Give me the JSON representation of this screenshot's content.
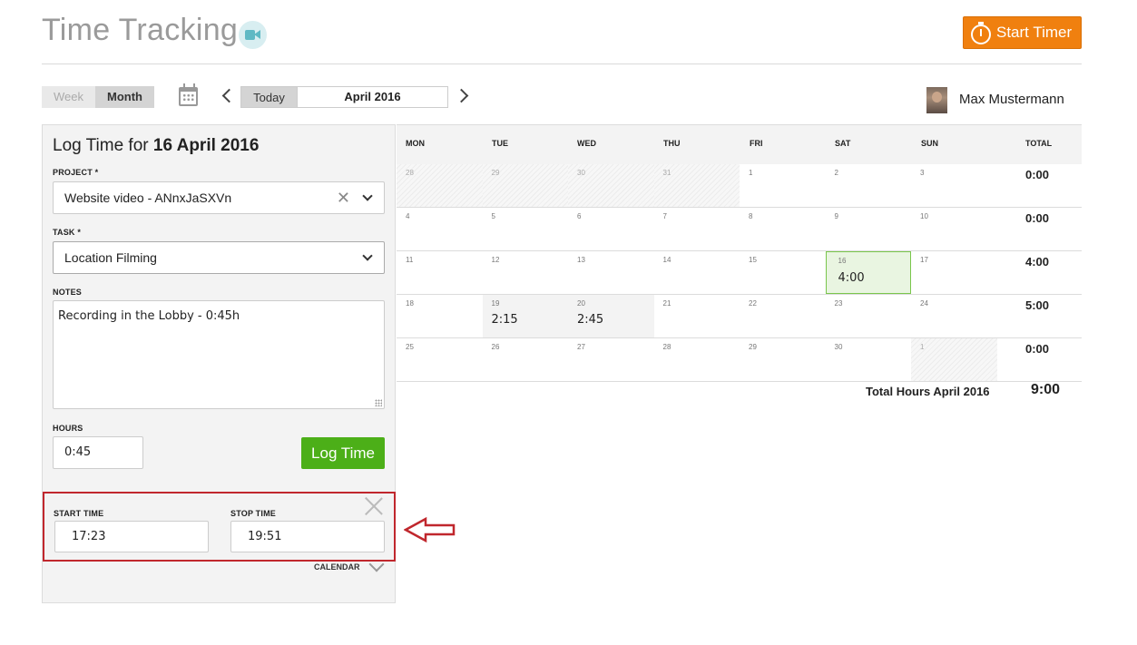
{
  "header": {
    "title": "Time Tracking",
    "start_timer_label": "Start Timer"
  },
  "toolbar": {
    "view_week": "Week",
    "view_month": "Month",
    "today_label": "Today",
    "period_label": "April 2016",
    "user_name": "Max Mustermann"
  },
  "log_form": {
    "title_prefix": "Log Time for ",
    "title_date": "16 April 2016",
    "project_label": "PROJECT *",
    "project_value": "Website video - ANnxJaSXVn",
    "task_label": "TASK *",
    "task_value": "Location Filming",
    "notes_label": "NOTES",
    "notes_value": "Recording in the Lobby - 0:45h",
    "hours_label": "HOURS",
    "hours_value": "0:45",
    "log_button": "Log Time",
    "start_time_label": "START TIME",
    "start_time_value": "17:23",
    "stop_time_label": "STOP TIME",
    "stop_time_value": "19:51",
    "calendar_toggle": "CALENDAR"
  },
  "calendar": {
    "headers": [
      "MON",
      "TUE",
      "WED",
      "THU",
      "FRI",
      "SAT",
      "SUN",
      "TOTAL"
    ],
    "weeks": [
      {
        "days": [
          {
            "d": "28",
            "h": "",
            "style": "hatch"
          },
          {
            "d": "29",
            "h": "",
            "style": "hatch"
          },
          {
            "d": "30",
            "h": "",
            "style": "hatch"
          },
          {
            "d": "31",
            "h": "",
            "style": "hatch"
          },
          {
            "d": "1",
            "h": "",
            "style": ""
          },
          {
            "d": "2",
            "h": "",
            "style": ""
          },
          {
            "d": "3",
            "h": "",
            "style": ""
          }
        ],
        "total": "0:00"
      },
      {
        "days": [
          {
            "d": "4",
            "h": "",
            "style": ""
          },
          {
            "d": "5",
            "h": "",
            "style": ""
          },
          {
            "d": "6",
            "h": "",
            "style": ""
          },
          {
            "d": "7",
            "h": "",
            "style": ""
          },
          {
            "d": "8",
            "h": "",
            "style": ""
          },
          {
            "d": "9",
            "h": "",
            "style": ""
          },
          {
            "d": "10",
            "h": "",
            "style": ""
          }
        ],
        "total": "0:00"
      },
      {
        "days": [
          {
            "d": "11",
            "h": "",
            "style": ""
          },
          {
            "d": "12",
            "h": "",
            "style": ""
          },
          {
            "d": "13",
            "h": "",
            "style": ""
          },
          {
            "d": "14",
            "h": "",
            "style": ""
          },
          {
            "d": "15",
            "h": "",
            "style": ""
          },
          {
            "d": "16",
            "h": "4:00",
            "style": "selected"
          },
          {
            "d": "17",
            "h": "",
            "style": ""
          }
        ],
        "total": "4:00"
      },
      {
        "days": [
          {
            "d": "18",
            "h": "",
            "style": ""
          },
          {
            "d": "19",
            "h": "2:15",
            "style": "filled"
          },
          {
            "d": "20",
            "h": "2:45",
            "style": "filled"
          },
          {
            "d": "21",
            "h": "",
            "style": ""
          },
          {
            "d": "22",
            "h": "",
            "style": ""
          },
          {
            "d": "23",
            "h": "",
            "style": ""
          },
          {
            "d": "24",
            "h": "",
            "style": ""
          }
        ],
        "total": "5:00"
      },
      {
        "days": [
          {
            "d": "25",
            "h": "",
            "style": ""
          },
          {
            "d": "26",
            "h": "",
            "style": ""
          },
          {
            "d": "27",
            "h": "",
            "style": ""
          },
          {
            "d": "28",
            "h": "",
            "style": ""
          },
          {
            "d": "29",
            "h": "",
            "style": ""
          },
          {
            "d": "30",
            "h": "",
            "style": ""
          },
          {
            "d": "1",
            "h": "",
            "style": "hatch"
          }
        ],
        "total": "0:00"
      }
    ],
    "grand_total_label": "Total Hours April 2016",
    "grand_total_value": "9:00"
  },
  "colors": {
    "start_timer": "#f0800f",
    "log_button": "#4caf18",
    "selected_day": "#e9f5e1",
    "annotation_red": "#c0272d"
  },
  "icons": [
    "video-icon",
    "stopwatch-icon",
    "calendar-icon",
    "chevron-left-icon",
    "chevron-right-icon",
    "clear-icon",
    "chevron-down-icon",
    "close-icon",
    "annotation-arrow-icon"
  ]
}
